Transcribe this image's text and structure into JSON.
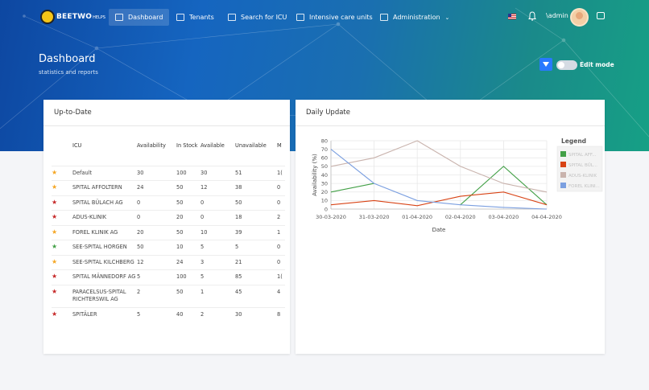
{
  "nav": {
    "logo_main": "BEETWO",
    "logo_sub": "HELPS",
    "items": [
      {
        "label": "Dashboard"
      },
      {
        "label": "Tenants"
      },
      {
        "label": "Search for ICU"
      },
      {
        "label": "Intensive care units"
      },
      {
        "label": "Administration"
      }
    ],
    "user": "\\admin"
  },
  "header": {
    "title": "Dashboard",
    "subtitle": "statistics and reports",
    "edit_mode_label": "Edit mode"
  },
  "left_card": {
    "title": "Up-to-Date",
    "columns": [
      "ICU",
      "Availability",
      "In Stock",
      "Available",
      "Unavailable",
      "M"
    ],
    "rows": [
      {
        "star": "#f5a623",
        "icu": "Default",
        "availability": "30",
        "in_stock": "100",
        "available": "30",
        "unavailable": "51",
        "m": "1("
      },
      {
        "star": "#f5a623",
        "icu": "SPITAL AFFOLTERN",
        "availability": "24",
        "in_stock": "50",
        "available": "12",
        "unavailable": "38",
        "m": "0"
      },
      {
        "star": "#c62828",
        "icu": "SPITAL BÜLACH AG",
        "availability": "0",
        "in_stock": "50",
        "available": "0",
        "unavailable": "50",
        "m": "0"
      },
      {
        "star": "#c62828",
        "icu": "ADUS-KLINIK",
        "availability": "0",
        "in_stock": "20",
        "available": "0",
        "unavailable": "18",
        "m": "2"
      },
      {
        "star": "#f5a623",
        "icu": "FOREL KLINIK AG",
        "availability": "20",
        "in_stock": "50",
        "available": "10",
        "unavailable": "39",
        "m": "1"
      },
      {
        "star": "#43a047",
        "icu": "SEE-SPITAL HORGEN",
        "availability": "50",
        "in_stock": "10",
        "available": "5",
        "unavailable": "5",
        "m": "0"
      },
      {
        "star": "#f5a623",
        "icu": "SEE-SPITAL KILCHBERG",
        "availability": "12",
        "in_stock": "24",
        "available": "3",
        "unavailable": "21",
        "m": "0"
      },
      {
        "star": "#c62828",
        "icu": "SPITAL MÄNNEDORF AG",
        "availability": "5",
        "in_stock": "100",
        "available": "5",
        "unavailable": "85",
        "m": "1("
      },
      {
        "star": "#c62828",
        "icu": "PARACELSUS-SPITAL RICHTERSWIL AG",
        "availability": "2",
        "in_stock": "50",
        "available": "1",
        "unavailable": "45",
        "m": "4"
      },
      {
        "star": "#c62828",
        "icu": "SPITÄLER",
        "availability": "5",
        "in_stock": "40",
        "available": "2",
        "unavailable": "30",
        "m": "8"
      }
    ]
  },
  "right_card": {
    "title": "Daily Update"
  },
  "chart_data": {
    "type": "line",
    "title": "",
    "xlabel": "Date",
    "ylabel": "Availability (%)",
    "ylim": [
      0,
      80
    ],
    "yticks": [
      0,
      10,
      20,
      30,
      40,
      50,
      60,
      70,
      80
    ],
    "categories": [
      "30-03-2020",
      "31-03-2020",
      "01-04-2020",
      "02-04-2020",
      "03-04-2020",
      "04-04-2020"
    ],
    "legend_title": "Legend",
    "legend_position": "right",
    "grid": true,
    "series": [
      {
        "name": "SPITAL AFF...",
        "color": "#43a047",
        "values": [
          20,
          30,
          null,
          5,
          50,
          5
        ]
      },
      {
        "name": "SPITAL BÜL...",
        "color": "#d84315",
        "values": [
          5,
          10,
          4,
          15,
          20,
          5
        ]
      },
      {
        "name": "ADUS-KLINIK",
        "color": "#c9b3ad",
        "values": [
          50,
          60,
          80,
          50,
          30,
          20
        ]
      },
      {
        "name": "FOREL KLINI...",
        "color": "#7b9fe0",
        "values": [
          70,
          30,
          10,
          5,
          2,
          0
        ]
      }
    ]
  }
}
